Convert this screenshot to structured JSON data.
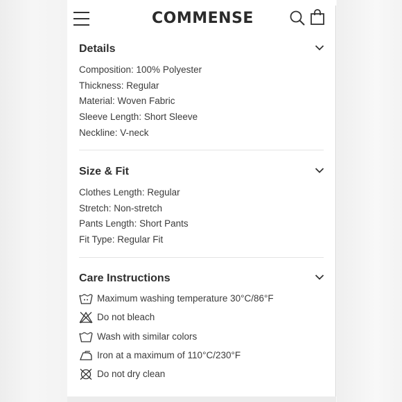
{
  "header": {
    "brand": "COMMENSE"
  },
  "sections": {
    "details": {
      "title": "Details",
      "items": [
        "Composition: 100% Polyester",
        "Thickness: Regular",
        "Material: Woven Fabric",
        "Sleeve Length: Short Sleeve",
        "Neckline: V-neck"
      ]
    },
    "size_fit": {
      "title": "Size & Fit",
      "items": [
        "Clothes Length: Regular",
        "Stretch: Non-stretch",
        "Pants Length: Short Pants",
        "Fit Type: Regular Fit"
      ]
    },
    "care": {
      "title": "Care Instructions",
      "items": [
        {
          "icon": "wash-30-icon",
          "text": "Maximum washing temperature 30°C/86°F"
        },
        {
          "icon": "do-not-bleach-icon",
          "text": "Do not bleach"
        },
        {
          "icon": "wash-tub-icon",
          "text": "Wash with similar colors"
        },
        {
          "icon": "iron-icon",
          "text": "Iron at a maximum of 110°C/230°F"
        },
        {
          "icon": "do-not-dry-clean-icon",
          "text": "Do not dry clean"
        }
      ]
    }
  },
  "colors": {
    "text": "#3b3b3b",
    "heading": "#2f2f2f",
    "divider": "#e4e4e4"
  }
}
